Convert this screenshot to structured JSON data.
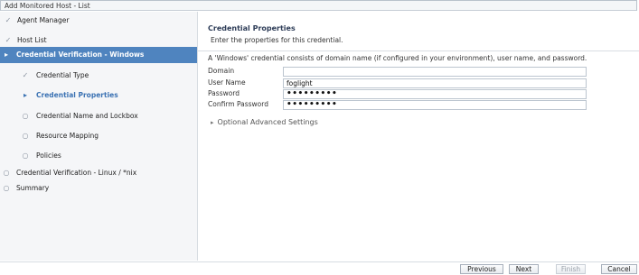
{
  "window": {
    "title": "Add Monitored Host - List"
  },
  "sidebar": {
    "items": [
      {
        "label": "Agent Manager",
        "marker": "✓",
        "state": "done"
      },
      {
        "label": "Host List",
        "marker": "✓",
        "state": "done"
      },
      {
        "label": "Credential Verification - Windows",
        "marker": "▸",
        "state": "active"
      },
      {
        "label": "Credential Type",
        "marker": "✓",
        "state": "done"
      },
      {
        "label": "Credential Properties",
        "marker": "▸",
        "state": "current"
      },
      {
        "label": "Credential Name and Lockbox",
        "marker": "○",
        "state": "pending"
      },
      {
        "label": "Resource Mapping",
        "marker": "○",
        "state": "pending"
      },
      {
        "label": "Policies",
        "marker": "○",
        "state": "pending"
      },
      {
        "label": "Credential Verification - Linux / *nix",
        "marker": "○",
        "state": "pending"
      },
      {
        "label": "Summary",
        "marker": "○",
        "state": "pending"
      }
    ]
  },
  "main": {
    "title": "Credential Properties",
    "subtitle": "Enter the properties for this credential.",
    "description": "A 'Windows' credential consists of domain name (if configured in your environment), user name, and password.",
    "form": {
      "domain_label": "Domain",
      "domain_value": "",
      "username_label": "User Name",
      "username_value": "foglight",
      "password_label": "Password",
      "password_value": "•••••••••",
      "confirm_label": "Confirm Password",
      "confirm_value": "•••••••••"
    },
    "optional_settings_label": "Optional Advanced Settings",
    "optional_settings_icon": "chevron-right-icon"
  },
  "footer": {
    "previous_label": "Previous",
    "next_label": "Next",
    "finish_label": "Finish",
    "cancel_label": "Cancel"
  },
  "colors": {
    "active_nav_bg": "#4f84bf",
    "current_nav_text": "#3b72b3",
    "title_text": "#2e3d58"
  }
}
